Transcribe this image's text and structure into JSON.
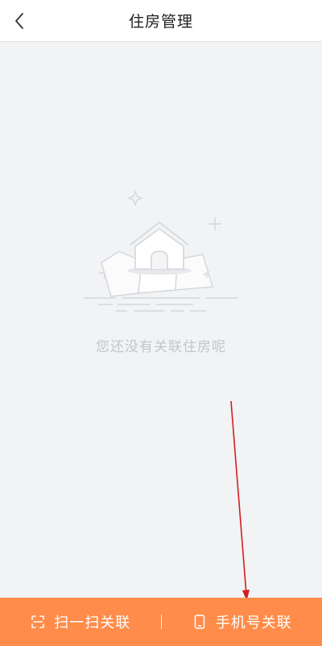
{
  "header": {
    "title": "住房管理",
    "back_icon": "chevron-left-icon"
  },
  "empty_state": {
    "illustration_icon": "empty-house-icon",
    "message": "您还没有关联住房呢"
  },
  "bottom_bar": {
    "scan_label": "扫一扫关联",
    "scan_icon": "scan-icon",
    "phone_label": "手机号关联",
    "phone_icon": "phone-icon"
  },
  "colors": {
    "accent": "#ff8c4a",
    "background": "#f2f3f5",
    "annotation_arrow": "#d11f1f"
  }
}
